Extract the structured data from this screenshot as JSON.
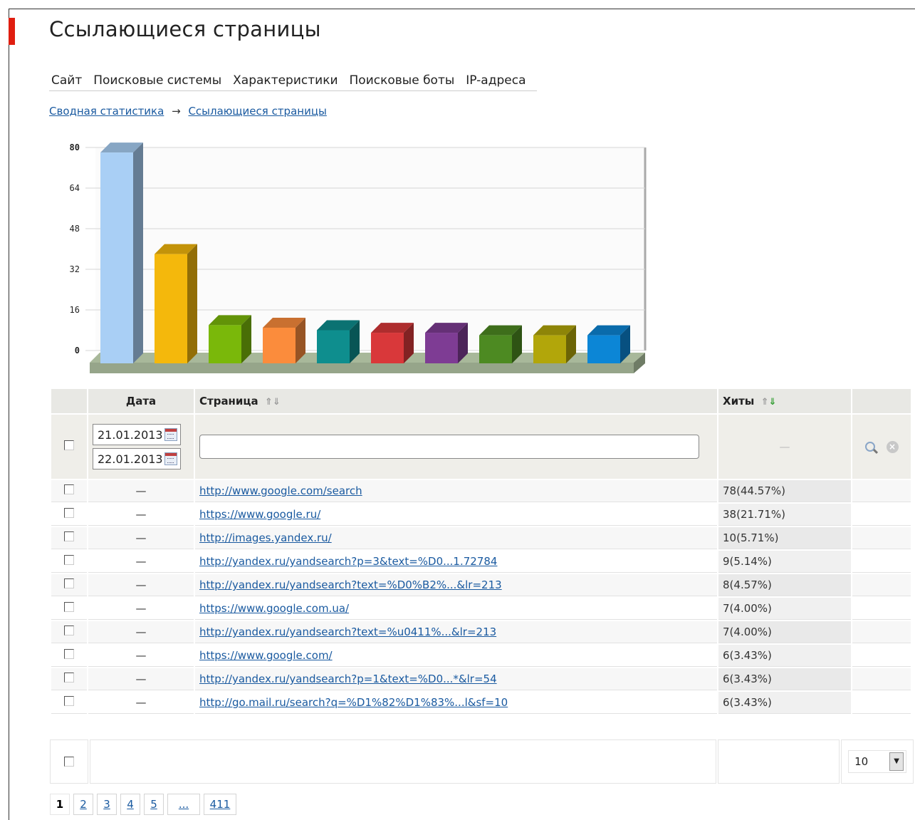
{
  "page": {
    "title": "Ссылающиеся страницы"
  },
  "tabs": [
    {
      "label": "Сайт"
    },
    {
      "label": "Поисковые системы"
    },
    {
      "label": "Характеристики"
    },
    {
      "label": "Поисковые боты"
    },
    {
      "label": "IP-адреса"
    }
  ],
  "breadcrumb": {
    "root": "Сводная статистика",
    "separator": "→",
    "current": "Ссылающиеся страницы"
  },
  "chart_data": {
    "type": "bar",
    "ylim": [
      0,
      80
    ],
    "yticks": [
      "0",
      "16",
      "32",
      "48",
      "64",
      "80"
    ],
    "categories": [
      "http://www.google.com/search",
      "https://www.google.ru/",
      "http://images.yandex.ru/",
      "http://yandex.ru/yandsearch?p=3&text=%D0...1.72784",
      "http://yandex.ru/yandsearch?text=%D0%B2%...&lr=213",
      "https://www.google.com.ua/",
      "http://yandex.ru/yandsearch?text=%u0411%...&lr=213",
      "https://www.google.com/",
      "http://yandex.ru/yandsearch?p=1&text=%D0...*&lr=54",
      "http://go.mail.ru/search?q=%D1%82%D1%83%...l&sf=10"
    ],
    "values": [
      78,
      38,
      10,
      9,
      8,
      7,
      7,
      6,
      6,
      6
    ],
    "colors": [
      "#a9cff5",
      "#f4b80c",
      "#7ab80a",
      "#fb8c3c",
      "#0e8e8e",
      "#d9383a",
      "#7e3c94",
      "#4d8a22",
      "#b2a60a",
      "#0c86d6"
    ],
    "grid": true
  },
  "table": {
    "headers": {
      "date": "Дата",
      "page": "Страница",
      "hits": "Хиты"
    },
    "sort_up": "⇑",
    "sort_down": "⇓",
    "filter": {
      "date_from": "21.01.2013",
      "date_to": "22.01.2013",
      "page_value": "",
      "hits_placeholder": "—"
    },
    "rows": [
      {
        "date": "—",
        "page": "http://www.google.com/search",
        "hits": "78(44.57%)"
      },
      {
        "date": "—",
        "page": "https://www.google.ru/",
        "hits": "38(21.71%)"
      },
      {
        "date": "—",
        "page": "http://images.yandex.ru/",
        "hits": "10(5.71%)"
      },
      {
        "date": "—",
        "page": "http://yandex.ru/yandsearch?p=3&text=%D0...1.72784",
        "hits": "9(5.14%)"
      },
      {
        "date": "—",
        "page": "http://yandex.ru/yandsearch?text=%D0%B2%...&lr=213",
        "hits": "8(4.57%)"
      },
      {
        "date": "—",
        "page": "https://www.google.com.ua/",
        "hits": "7(4.00%)"
      },
      {
        "date": "—",
        "page": "http://yandex.ru/yandsearch?text=%u0411%...&lr=213",
        "hits": "7(4.00%)"
      },
      {
        "date": "—",
        "page": "https://www.google.com/",
        "hits": "6(3.43%)"
      },
      {
        "date": "—",
        "page": "http://yandex.ru/yandsearch?p=1&text=%D0...*&lr=54",
        "hits": "6(3.43%)"
      },
      {
        "date": "—",
        "page": "http://go.mail.ru/search?q=%D1%82%D1%83%...l&sf=10",
        "hits": "6(3.43%)"
      }
    ]
  },
  "footer": {
    "per_page": "10"
  },
  "pagination": {
    "pages": [
      "1",
      "2",
      "3",
      "4",
      "5",
      "...",
      "411"
    ],
    "current": "1"
  }
}
